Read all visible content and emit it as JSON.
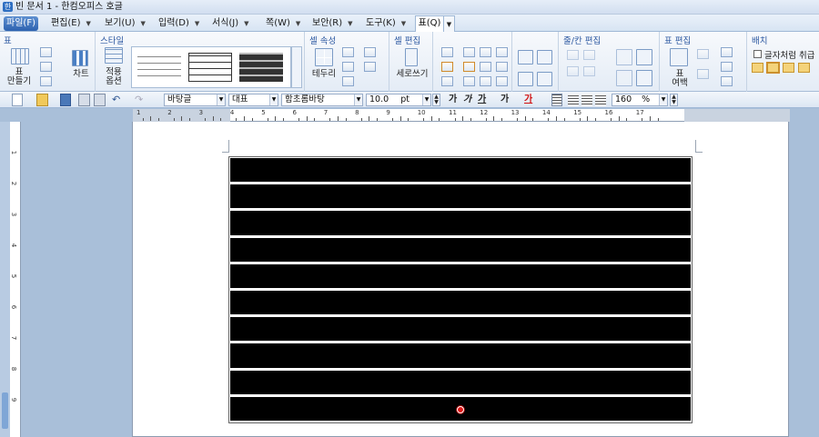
{
  "window": {
    "title": "빈 문서 1 - 한컴오피스 호글"
  },
  "menu": [
    {
      "label": "파일(F)"
    },
    {
      "label": "편집(E)"
    },
    {
      "label": "보기(U)"
    },
    {
      "label": "입력(D)"
    },
    {
      "label": "서식(J)"
    },
    {
      "label": "쪽(W)"
    },
    {
      "label": "보안(R)"
    },
    {
      "label": "도구(K)"
    },
    {
      "label": "표(Q)"
    }
  ],
  "ribbon": {
    "table_group": {
      "label": "표",
      "make_table": "표\n만들기",
      "chart": "차트"
    },
    "style_group": {
      "label": "스타일",
      "apply": "적용\n옵션"
    },
    "cell_props": {
      "label": "셀 속성",
      "border": "테두리"
    },
    "cell_edit": {
      "label": "셀 편집",
      "vertical": "세로쓰기"
    },
    "rowcol_edit": {
      "label": "줄/칸 편집"
    },
    "table_edit": {
      "label": "표 편집",
      "margin": "표\n여백"
    },
    "arrange": {
      "label": "배치",
      "treat_as_char": "글자처럼 취급"
    }
  },
  "toolbar": {
    "style": "바탕글",
    "para": "대표",
    "font": "함초롬바탕",
    "size": "10.0",
    "size_unit": "pt",
    "bold": "가",
    "italic": "가",
    "underline": "가",
    "strike": "가",
    "color": "가",
    "zoom": "160",
    "zoom_unit": "%"
  },
  "ruler": {
    "numbers": [
      "1",
      "2",
      "3",
      "4",
      "5",
      "6",
      "7",
      "8",
      "9",
      "10",
      "11",
      "12",
      "13",
      "14",
      "15",
      "16",
      "17"
    ]
  },
  "table": {
    "rows": 10,
    "fill": "#000000"
  },
  "colors": {
    "accent": "#2d62b0",
    "background": "#a9bfd9",
    "marker": "#e01616"
  }
}
